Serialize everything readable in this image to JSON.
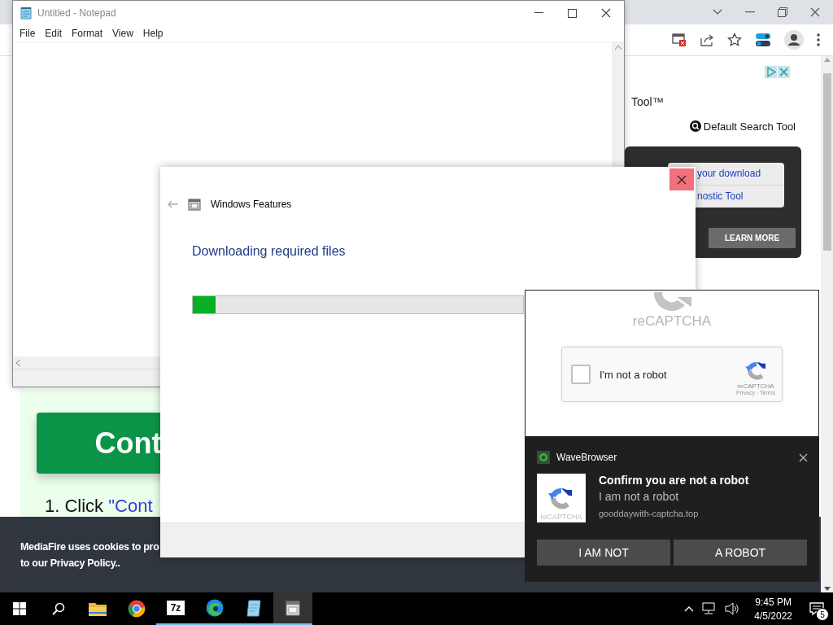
{
  "browser": {
    "ad": {
      "title_fragment": "Tool™",
      "search_tool": "Default Search Tool",
      "links": [
        "your download",
        "nostic Tool"
      ],
      "button": "LEARN MORE"
    },
    "page": {
      "button": "Cont",
      "steps": [
        {
          "prefix": "1. Click ",
          "link": "\"Cont"
        }
      ]
    },
    "cookie_banner": {
      "lines": [
        "MediaFire uses cookies to pro",
        "to our Privacy Policy.."
      ]
    }
  },
  "notepad": {
    "title": "Untitled - Notepad",
    "menu": [
      "File",
      "Edit",
      "Format",
      "View",
      "Help"
    ]
  },
  "dialog": {
    "title": "Windows Features",
    "heading": "Downloading required files",
    "progress": {
      "level": 0.07
    }
  },
  "captcha": {
    "logo_text": "reCAPTCHA",
    "checkbox": {
      "label": "I'm not a robot",
      "checked": false
    },
    "badge": "reCAPTCHA",
    "links": "Privacy - Terms"
  },
  "notification": {
    "app": "WaveBrowser",
    "title": "Confirm you are not a robot",
    "body": "I am not a robot",
    "source": "gooddaywith-captcha.top",
    "image_caption": "reCAPTCHA",
    "buttons": [
      "I AM NOT",
      "A ROBOT"
    ]
  },
  "taskbar": {
    "apps": [
      {
        "kind": "folder",
        "running": false,
        "active": false
      },
      {
        "kind": "browser",
        "running": false,
        "active": false
      },
      {
        "kind": "archiver",
        "label": "7z",
        "running": true,
        "active": false
      },
      {
        "kind": "swirl",
        "running": true,
        "active": false
      },
      {
        "kind": "notepad",
        "running": true,
        "active": false
      },
      {
        "kind": "features",
        "running": true,
        "active": true
      }
    ],
    "time": "9:45 PM",
    "date": "4/5/2022",
    "notification_count": "5"
  }
}
